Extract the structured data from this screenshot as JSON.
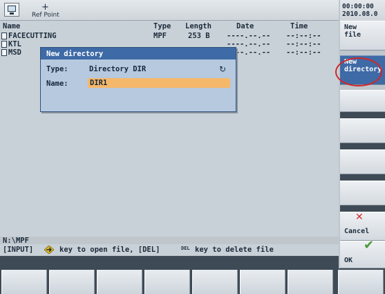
{
  "header": {
    "ref_point_label": "Ref Point",
    "clock": "00:00:00\n2010.08.0"
  },
  "columns": {
    "name": "Name",
    "type": "Type",
    "length": "Length",
    "date": "Date",
    "time": "Time"
  },
  "files": [
    {
      "name": "FACECUTTING",
      "type": "MPF",
      "length": "253 B",
      "date": "----.--.--",
      "time": "--:--:--"
    },
    {
      "name": "KTL",
      "type": "",
      "length": "",
      "date": "----.--.--",
      "time": "--:--:--"
    },
    {
      "name": "MSD",
      "type": "",
      "length": "",
      "date": "----.--.--",
      "time": "--:--:--"
    }
  ],
  "dialog": {
    "title": "New directory",
    "type_label": "Type:",
    "type_value": "Directory DIR",
    "name_label": "Name:",
    "name_value": "DIR1"
  },
  "path": "N:\\MPF",
  "hint": {
    "part1": "[INPUT]",
    "part2": "key to open file, [DEL]",
    "del_key": "DEL",
    "part3": "key to delete file"
  },
  "softkeys": {
    "new_file": "New\nfile",
    "new_directory": "New\ndirectory",
    "cancel": "Cancel",
    "ok": "OK"
  },
  "colors": {
    "accent": "#3e6aa6",
    "input_highlight": "#f5b86a",
    "cancel": "#d3272a",
    "ok": "#4a9a3a"
  }
}
